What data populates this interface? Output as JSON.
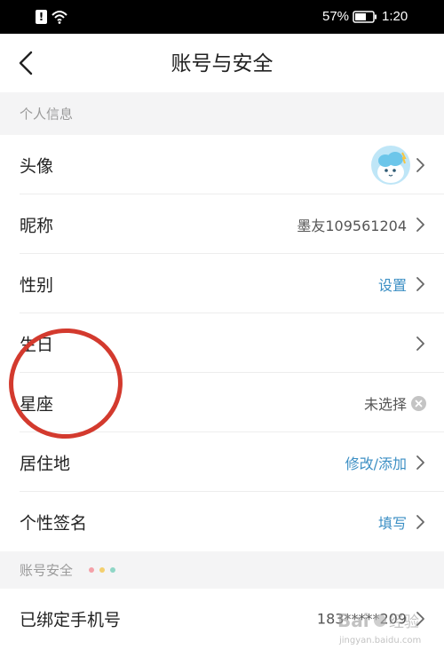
{
  "status_bar": {
    "alert_glyph": "!",
    "battery_percent": "57%",
    "time": "1:20"
  },
  "header": {
    "title": "账号与安全"
  },
  "sections": [
    {
      "title": "个人信息",
      "rows": [
        {
          "label": "头像",
          "value": ""
        },
        {
          "label": "昵称",
          "value": "墨友109561204"
        },
        {
          "label": "性别",
          "value": "设置"
        },
        {
          "label": "生日",
          "value": ""
        },
        {
          "label": "星座",
          "value": "未选择"
        },
        {
          "label": "居住地",
          "value": "修改/添加"
        },
        {
          "label": "个性签名",
          "value": "填写"
        }
      ]
    },
    {
      "title": "账号安全",
      "rows": [
        {
          "label": "已绑定手机号",
          "value": "183*****209"
        }
      ]
    }
  ],
  "icons": {
    "back": "chevron-left-icon",
    "chevron": "chevron-right-icon",
    "clear": "clear-icon",
    "wifi": "wifi-icon",
    "battery": "battery-icon"
  },
  "colors": {
    "accent_blue": "#3c8fc4",
    "annotation_red": "#d33a2e",
    "section_bg": "#f4f4f5",
    "dots": [
      "#f4a0a8",
      "#f3cf6e",
      "#8fd6c6"
    ]
  },
  "watermark": {
    "brand": "Bai",
    "brand_cn": "经验",
    "url": "jingyan.baidu.com"
  }
}
